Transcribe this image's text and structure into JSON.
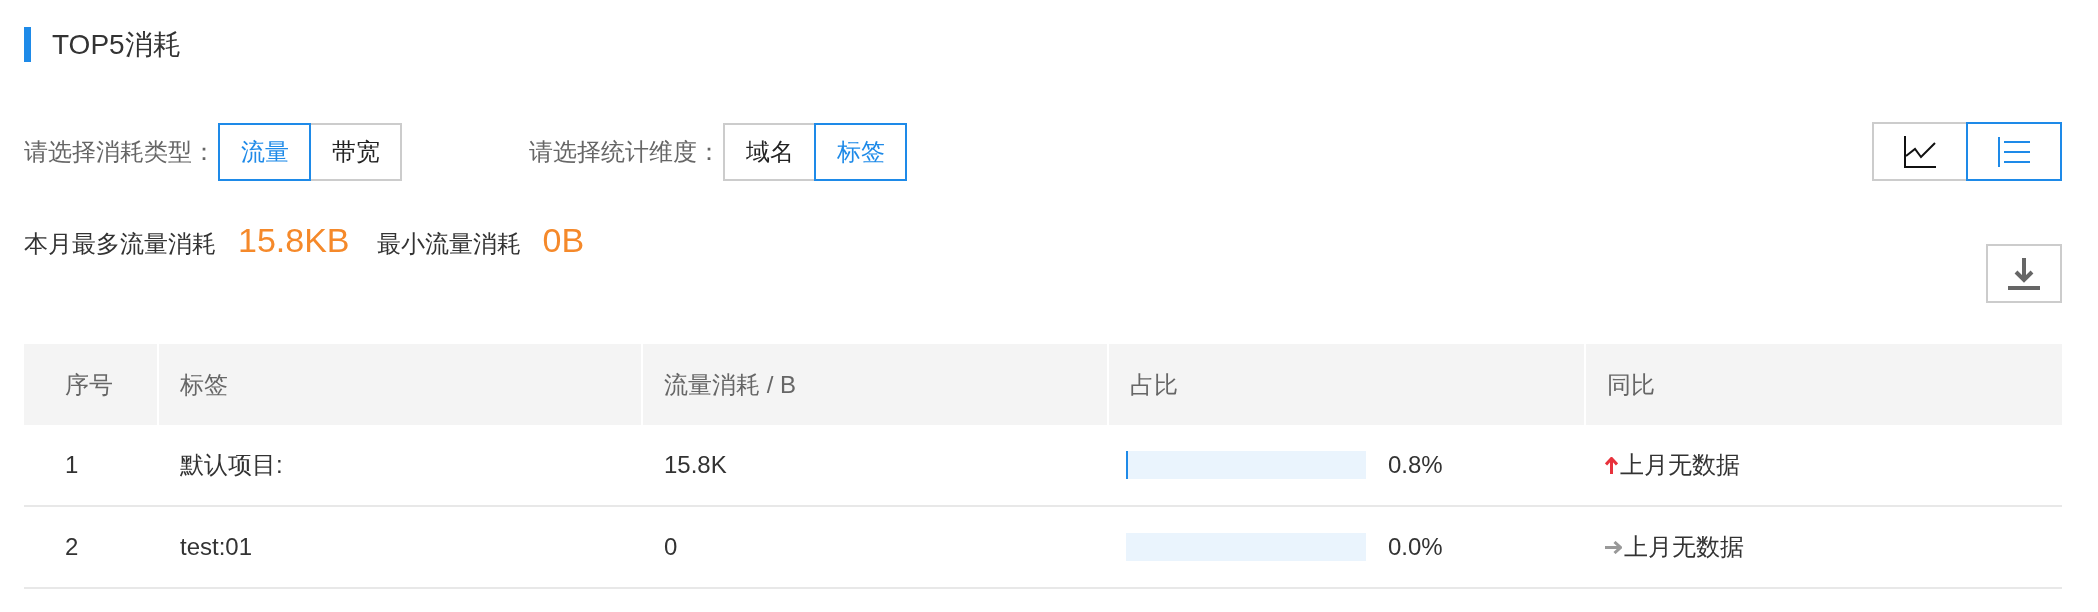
{
  "title": "TOP5消耗",
  "filters": [
    {
      "label": "请选择消耗类型：",
      "options": [
        {
          "label": "流量",
          "selected": true
        },
        {
          "label": "带宽",
          "selected": false
        }
      ]
    },
    {
      "label": "请选择统计维度：",
      "options": [
        {
          "label": "域名",
          "selected": false
        },
        {
          "label": "标签",
          "selected": true
        }
      ]
    }
  ],
  "view_toggle": [
    {
      "kind": "chart",
      "selected": false
    },
    {
      "kind": "list",
      "selected": true
    }
  ],
  "summary": [
    {
      "label": "本月最多流量消耗",
      "value": "15.8KB"
    },
    {
      "label": "最小流量消耗",
      "value": "0B"
    }
  ],
  "table": {
    "columns": [
      "序号",
      "标签",
      "流量消耗 / B",
      "占比",
      "同比"
    ],
    "rows": [
      {
        "index": "1",
        "tag": "默认项目:",
        "usage": "15.8K",
        "share": {
          "level": 0.008,
          "reading": "0.8%"
        },
        "kind": "up",
        "comparison": "上月无数据"
      },
      {
        "index": "2",
        "tag": "test:01",
        "usage": "0",
        "share": {
          "level": 0,
          "reading": "0.0%"
        },
        "kind": "flat",
        "comparison": "上月无数据"
      }
    ]
  }
}
